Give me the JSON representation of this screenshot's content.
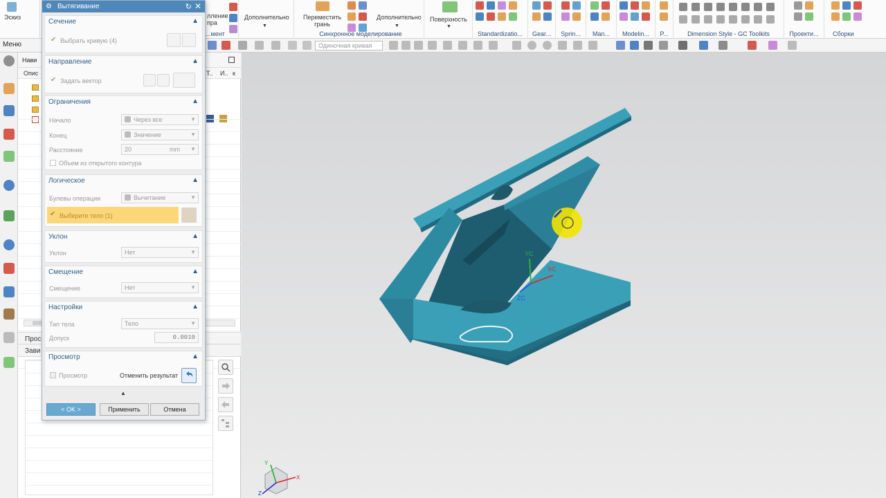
{
  "ribbon": {
    "sketch_label": "Эскиз",
    "groups": [
      {
        "label": "лление\nпра",
        "sub": "...мент"
      },
      {
        "label": "Дополнительно"
      },
      {
        "label": "Переместить\nгрань"
      },
      {
        "label": "Дополнительно"
      },
      {
        "label": "Синхронное моделирование"
      },
      {
        "label": "Поверхность"
      },
      {
        "label": "Standardizatio..."
      },
      {
        "label": "Gear..."
      },
      {
        "label": "Sprin..."
      },
      {
        "label": "Man..."
      },
      {
        "label": "Modelin..."
      },
      {
        "label": "P..."
      },
      {
        "label": "Dimension Style - GC Toolkits"
      },
      {
        "label": "Проекти..."
      },
      {
        "label": "Сборки"
      }
    ]
  },
  "toolbar2": {
    "menu_label": "Меню",
    "filter_value": "Одиночная кривая"
  },
  "navigator": {
    "title": "Нави",
    "col_description": "Опис",
    "col_t": "Т..",
    "col_i": "И..",
    "col_k": "к",
    "preview_label": "Просм",
    "dependencies_label": "Зави"
  },
  "dialog": {
    "title": "Вытягивание",
    "sections": {
      "section": {
        "header": "Сечение",
        "select_curve": "Выбрать кривую (4)"
      },
      "direction": {
        "header": "Направление",
        "set_vector": "Задать вектор"
      },
      "limits": {
        "header": "Ограничения",
        "start_label": "Начало",
        "start_value": "Через все",
        "end_label": "Конец",
        "end_value": "Значение",
        "distance_label": "Расстояние",
        "distance_value": "20",
        "distance_unit": "mm",
        "open_profile": "Объем из открытого контура"
      },
      "boolean": {
        "header": "Логическое",
        "op_label": "Булевы операции",
        "op_value": "Вычитание",
        "select_body": "Выберите тело (1)"
      },
      "draft": {
        "header": "Уклон",
        "label": "Уклон",
        "value": "Нет"
      },
      "offset": {
        "header": "Смещение",
        "label": "Смещение",
        "value": "Нет"
      },
      "settings": {
        "header": "Настройки",
        "body_type_label": "Тип тела",
        "body_type_value": "Тело",
        "tolerance_label": "Допуск",
        "tolerance_value": "0.0010"
      },
      "preview": {
        "header": "Просмотр",
        "preview_label": "Просмотр",
        "undo_label": "Отменить результат"
      }
    },
    "buttons": {
      "ok": "< OK >",
      "apply": "Применить",
      "cancel": "Отмена"
    }
  },
  "viewport": {
    "axis_yc": "YC",
    "axis_xc": "XC",
    "axis_zc": "ZC",
    "mini_x": "X",
    "mini_y": "Y",
    "mini_z": "Z",
    "colors": {
      "part": "#2e8fa6",
      "part_top": "#3aa0b8",
      "part_dark": "#1c5f73",
      "highlight": "#f3e200"
    }
  }
}
